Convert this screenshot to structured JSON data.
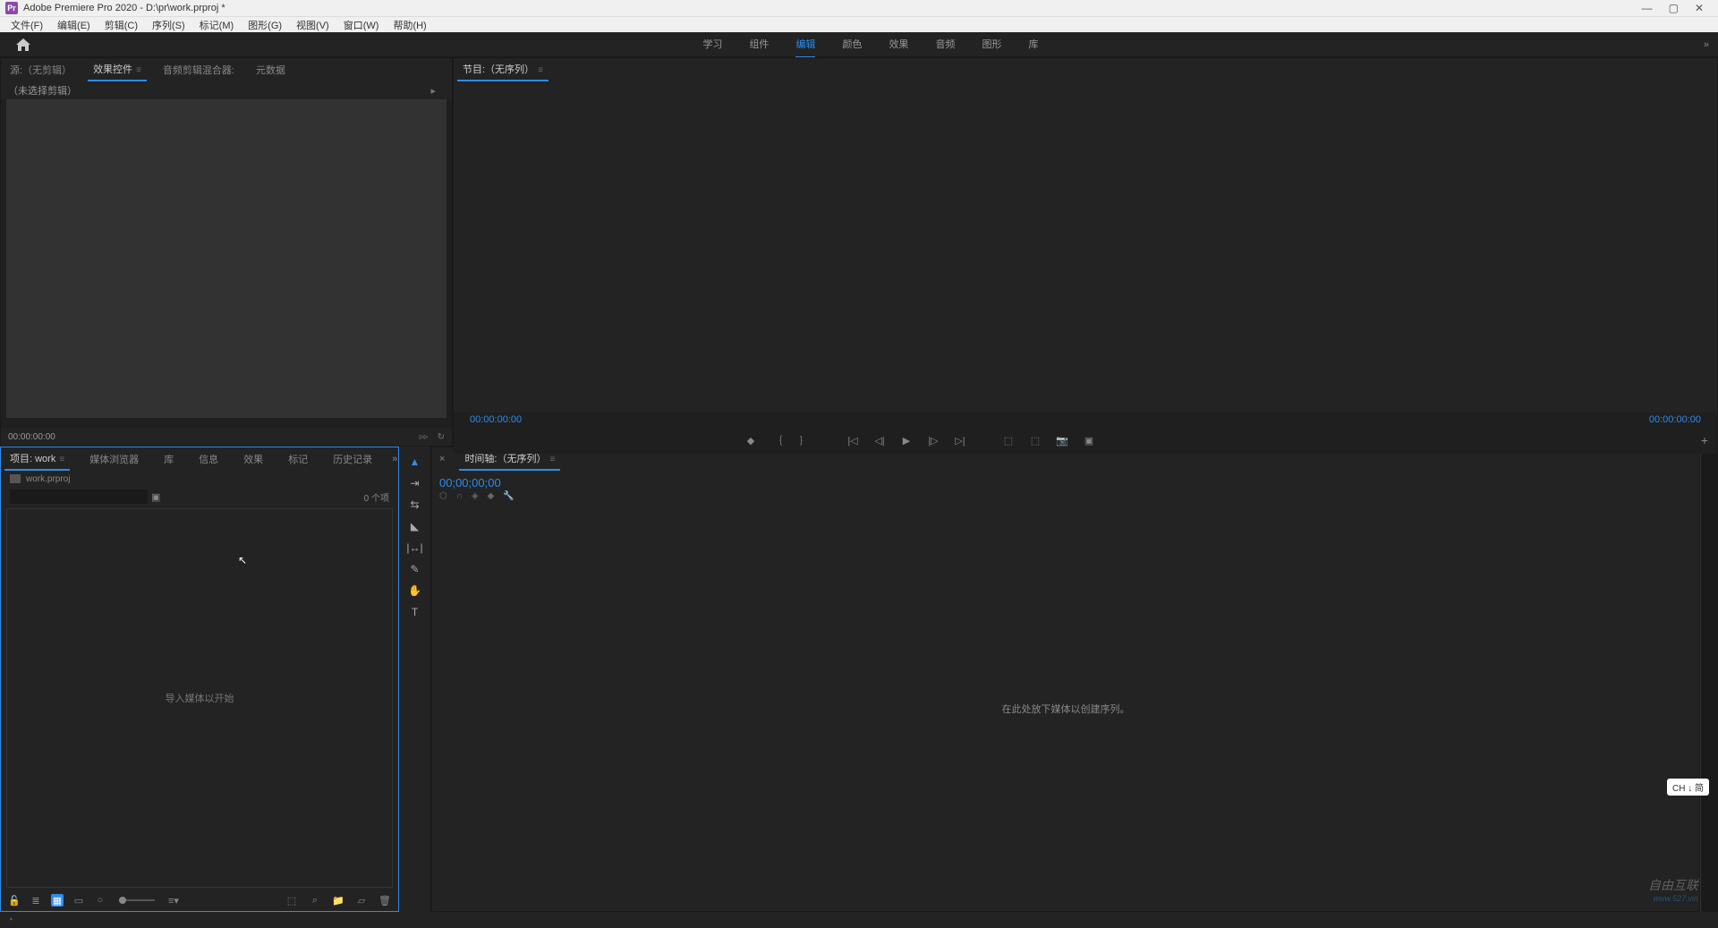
{
  "title_bar": {
    "app_icon": "Pr",
    "title": "Adobe Premiere Pro 2020 - D:\\pr\\work.prproj *"
  },
  "menu": {
    "items": [
      "文件(F)",
      "编辑(E)",
      "剪辑(C)",
      "序列(S)",
      "标记(M)",
      "图形(G)",
      "视图(V)",
      "窗口(W)",
      "帮助(H)"
    ]
  },
  "workspace": {
    "tabs": [
      "学习",
      "组件",
      "编辑",
      "颜色",
      "效果",
      "音频",
      "图形",
      "库"
    ],
    "active": "编辑"
  },
  "source_panel": {
    "tabs": [
      "源:（无剪辑）",
      "效果控件",
      "音频剪辑混合器:",
      "元数据"
    ],
    "active_index": 1,
    "clip_info": "（未选择剪辑）",
    "timecode": "00:00:00:00"
  },
  "program_panel": {
    "title": "节目:（无序列）",
    "timecode_left": "00:00:00:00",
    "timecode_right": "00:00:00:00"
  },
  "project_panel": {
    "tabs": [
      "项目: work",
      "媒体浏览器",
      "库",
      "信息",
      "效果",
      "标记",
      "历史记录"
    ],
    "active_index": 0,
    "filename": "work.prproj",
    "item_count": "0 个项",
    "drop_message": "导入媒体以开始"
  },
  "timeline_panel": {
    "title": "时间轴:（无序列）",
    "timecode": "00;00;00;00",
    "drop_message": "在此处放下媒体以创建序列。"
  },
  "ime": "CH ↓ 简",
  "watermark": {
    "line1": "自由互联",
    "line2": "www.527.vin"
  }
}
